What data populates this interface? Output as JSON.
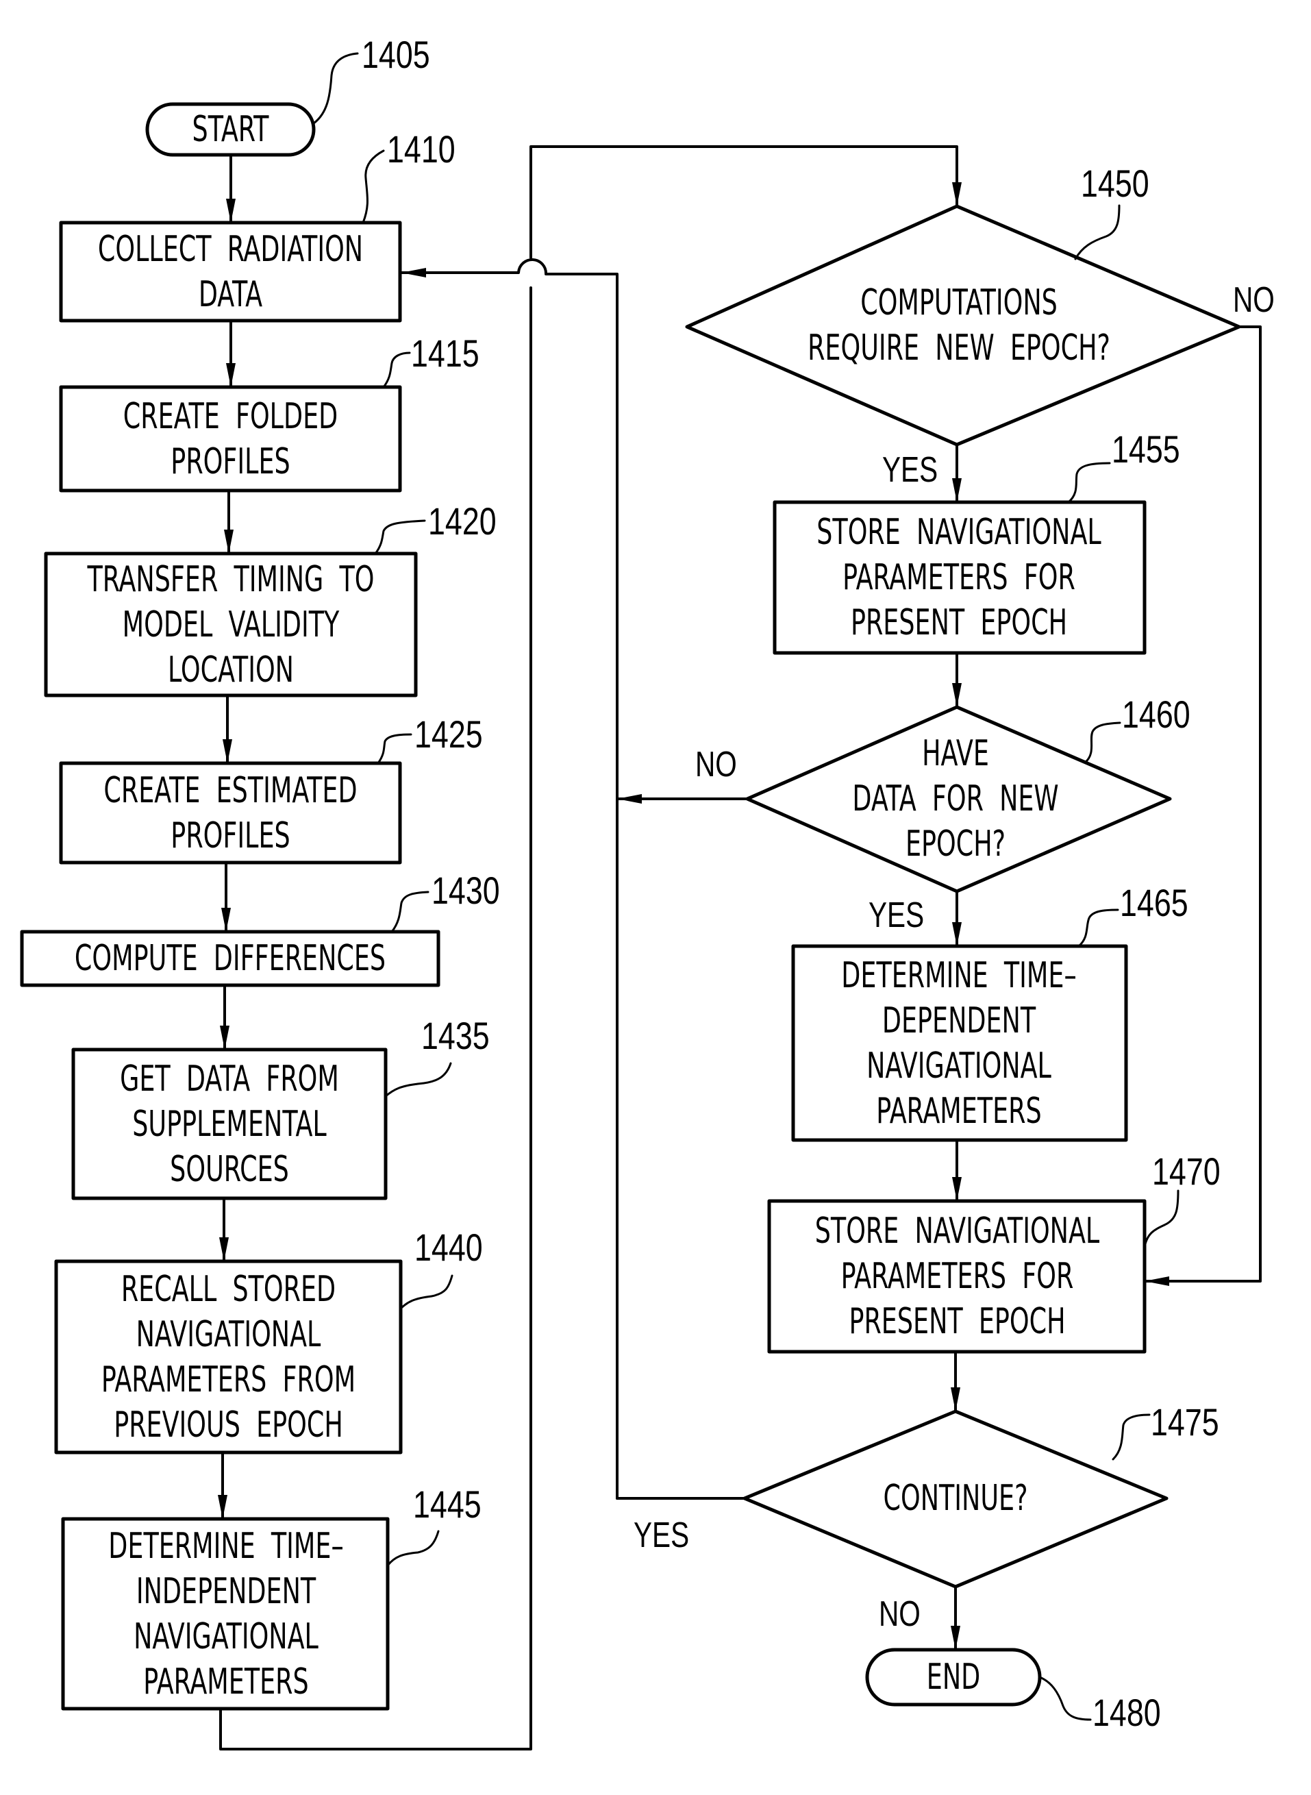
{
  "figure": {
    "nodes": [
      {
        "id": "1405",
        "type": "terminal",
        "lines": [
          "START"
        ]
      },
      {
        "id": "1410",
        "type": "process",
        "lines": [
          "COLLECT  RADIATION",
          "DATA"
        ]
      },
      {
        "id": "1415",
        "type": "process",
        "lines": [
          "CREATE  FOLDED",
          "PROFILES"
        ]
      },
      {
        "id": "1420",
        "type": "process",
        "lines": [
          "TRANSFER  TIMING  TO",
          "MODEL  VALIDITY",
          "LOCATION"
        ]
      },
      {
        "id": "1425",
        "type": "process",
        "lines": [
          "CREATE  ESTIMATED",
          "PROFILES"
        ]
      },
      {
        "id": "1430",
        "type": "process",
        "lines": [
          "COMPUTE  DIFFERENCES"
        ]
      },
      {
        "id": "1435",
        "type": "process",
        "lines": [
          "GET  DATA  FROM",
          "SUPPLEMENTAL",
          "SOURCES"
        ]
      },
      {
        "id": "1440",
        "type": "process",
        "lines": [
          "RECALL  STORED",
          "NAVIGATIONAL",
          "PARAMETERS  FROM",
          "PREVIOUS  EPOCH"
        ]
      },
      {
        "id": "1445",
        "type": "process",
        "lines": [
          "DETERMINE  TIME–",
          "INDEPENDENT",
          "NAVIGATIONAL",
          "PARAMETERS"
        ]
      },
      {
        "id": "1450",
        "type": "decision",
        "lines": [
          "COMPUTATIONS",
          "REQUIRE  NEW  EPOCH?"
        ]
      },
      {
        "id": "1455",
        "type": "process",
        "lines": [
          "STORE  NAVIGATIONAL",
          "PARAMETERS  FOR",
          "PRESENT  EPOCH"
        ]
      },
      {
        "id": "1460",
        "type": "decision",
        "lines": [
          "HAVE",
          "DATA  FOR  NEW",
          "EPOCH?"
        ]
      },
      {
        "id": "1465",
        "type": "process",
        "lines": [
          "DETERMINE  TIME–",
          "DEPENDENT",
          "NAVIGATIONAL",
          "PARAMETERS"
        ]
      },
      {
        "id": "1470",
        "type": "process",
        "lines": [
          "STORE  NAVIGATIONAL",
          "PARAMETERS  FOR",
          "PRESENT  EPOCH"
        ]
      },
      {
        "id": "1475",
        "type": "decision",
        "lines": [
          "CONTINUE?"
        ]
      },
      {
        "id": "1480",
        "type": "terminal",
        "lines": [
          "END"
        ]
      }
    ],
    "refs": [
      "1405",
      "1410",
      "1415",
      "1420",
      "1425",
      "1430",
      "1435",
      "1440",
      "1445",
      "1450",
      "1455",
      "1460",
      "1465",
      "1470",
      "1475",
      "1480"
    ],
    "branch_labels": {
      "d1450_no": "NO",
      "d1450_yes": "YES",
      "d1460_no": "NO",
      "d1460_yes": "YES",
      "d1475_yes": "YES",
      "d1475_no": "NO"
    },
    "edges": [
      {
        "from": "1405",
        "to": "1410"
      },
      {
        "from": "1410",
        "to": "1415"
      },
      {
        "from": "1415",
        "to": "1420"
      },
      {
        "from": "1420",
        "to": "1425"
      },
      {
        "from": "1425",
        "to": "1430"
      },
      {
        "from": "1430",
        "to": "1435"
      },
      {
        "from": "1435",
        "to": "1440"
      },
      {
        "from": "1440",
        "to": "1445"
      },
      {
        "from": "1445",
        "to": "1450"
      },
      {
        "from": "1450",
        "to": "1455",
        "label": "YES"
      },
      {
        "from": "1450",
        "to": "1470",
        "label": "NO"
      },
      {
        "from": "1455",
        "to": "1460"
      },
      {
        "from": "1460",
        "to": "1465",
        "label": "YES"
      },
      {
        "from": "1460",
        "to": "1410",
        "label": "NO"
      },
      {
        "from": "1465",
        "to": "1470"
      },
      {
        "from": "1470",
        "to": "1475"
      },
      {
        "from": "1475",
        "to": "1410",
        "label": "YES"
      },
      {
        "from": "1475",
        "to": "1480",
        "label": "NO"
      }
    ],
    "colors": {
      "ink": "#000000",
      "paper": "#ffffff"
    }
  }
}
